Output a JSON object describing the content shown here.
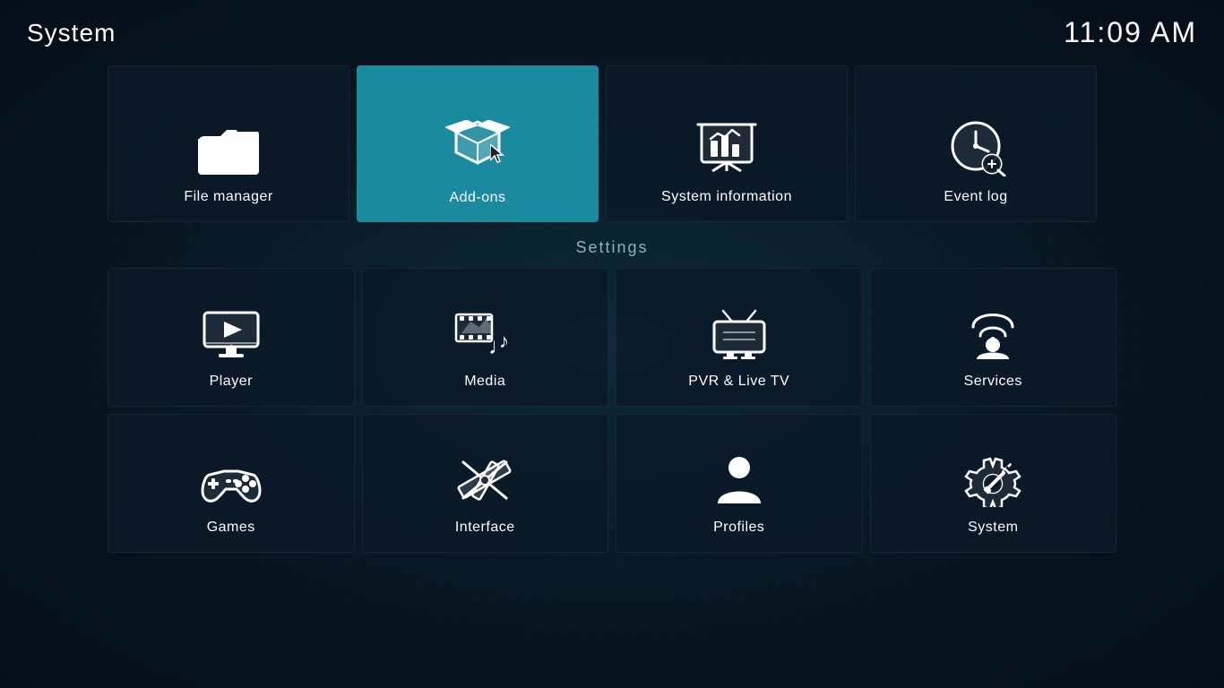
{
  "header": {
    "title": "System",
    "time": "11:09 AM"
  },
  "top_row": {
    "tiles": [
      {
        "id": "file-manager",
        "label": "File manager"
      },
      {
        "id": "add-ons",
        "label": "Add-ons",
        "active": true
      },
      {
        "id": "system-information",
        "label": "System information"
      },
      {
        "id": "event-log",
        "label": "Event log"
      }
    ]
  },
  "settings": {
    "label": "Settings",
    "tiles": [
      {
        "id": "player",
        "label": "Player"
      },
      {
        "id": "media",
        "label": "Media"
      },
      {
        "id": "pvr-live-tv",
        "label": "PVR & Live TV"
      },
      {
        "id": "services",
        "label": "Services"
      },
      {
        "id": "games",
        "label": "Games"
      },
      {
        "id": "interface",
        "label": "Interface"
      },
      {
        "id": "profiles",
        "label": "Profiles"
      },
      {
        "id": "system",
        "label": "System"
      }
    ]
  }
}
